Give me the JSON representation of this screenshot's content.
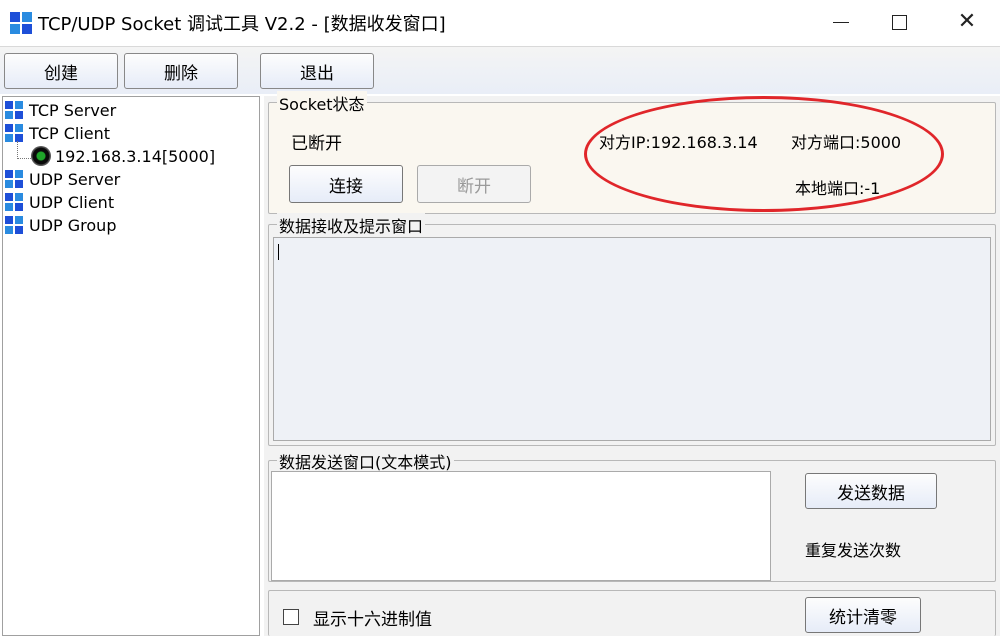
{
  "window": {
    "title": "TCP/UDP Socket 调试工具 V2.2 - [数据收发窗口]",
    "minimize_icon": "minimize-icon",
    "maximize_icon": "maximize-icon",
    "close_glyph": "✕"
  },
  "toolbar": {
    "create_label": "创建",
    "delete_label": "删除",
    "exit_label": "退出"
  },
  "tree": {
    "items": [
      {
        "label": "TCP Server",
        "icon": "network-grid-icon"
      },
      {
        "label": "TCP Client",
        "icon": "network-grid-icon"
      },
      {
        "label": "UDP Server",
        "icon": "network-grid-icon"
      },
      {
        "label": "UDP Client",
        "icon": "network-grid-icon"
      },
      {
        "label": "UDP Group",
        "icon": "network-grid-icon"
      }
    ],
    "client_connection": "192.168.3.14[5000]"
  },
  "socket_status": {
    "group_title": "Socket状态",
    "status": "已断开",
    "peer_ip": "对方IP:192.168.3.14",
    "peer_port": "对方端口:5000",
    "local_port": "本地端口:-1",
    "connect_label": "连接",
    "disconnect_label": "断开"
  },
  "receive": {
    "group_title": "数据接收及提示窗口",
    "content": ""
  },
  "send": {
    "group_title": "数据发送窗口(文本模式)",
    "content": "",
    "send_label": "发送数据",
    "repeat_label": "重复发送次数"
  },
  "options": {
    "hex_label": "显示十六进制值",
    "hex_checked": false,
    "clear_stats_label": "统计清零"
  },
  "colors": {
    "highlight": "#e0262a",
    "icon_blue": "#1e4fd8"
  }
}
